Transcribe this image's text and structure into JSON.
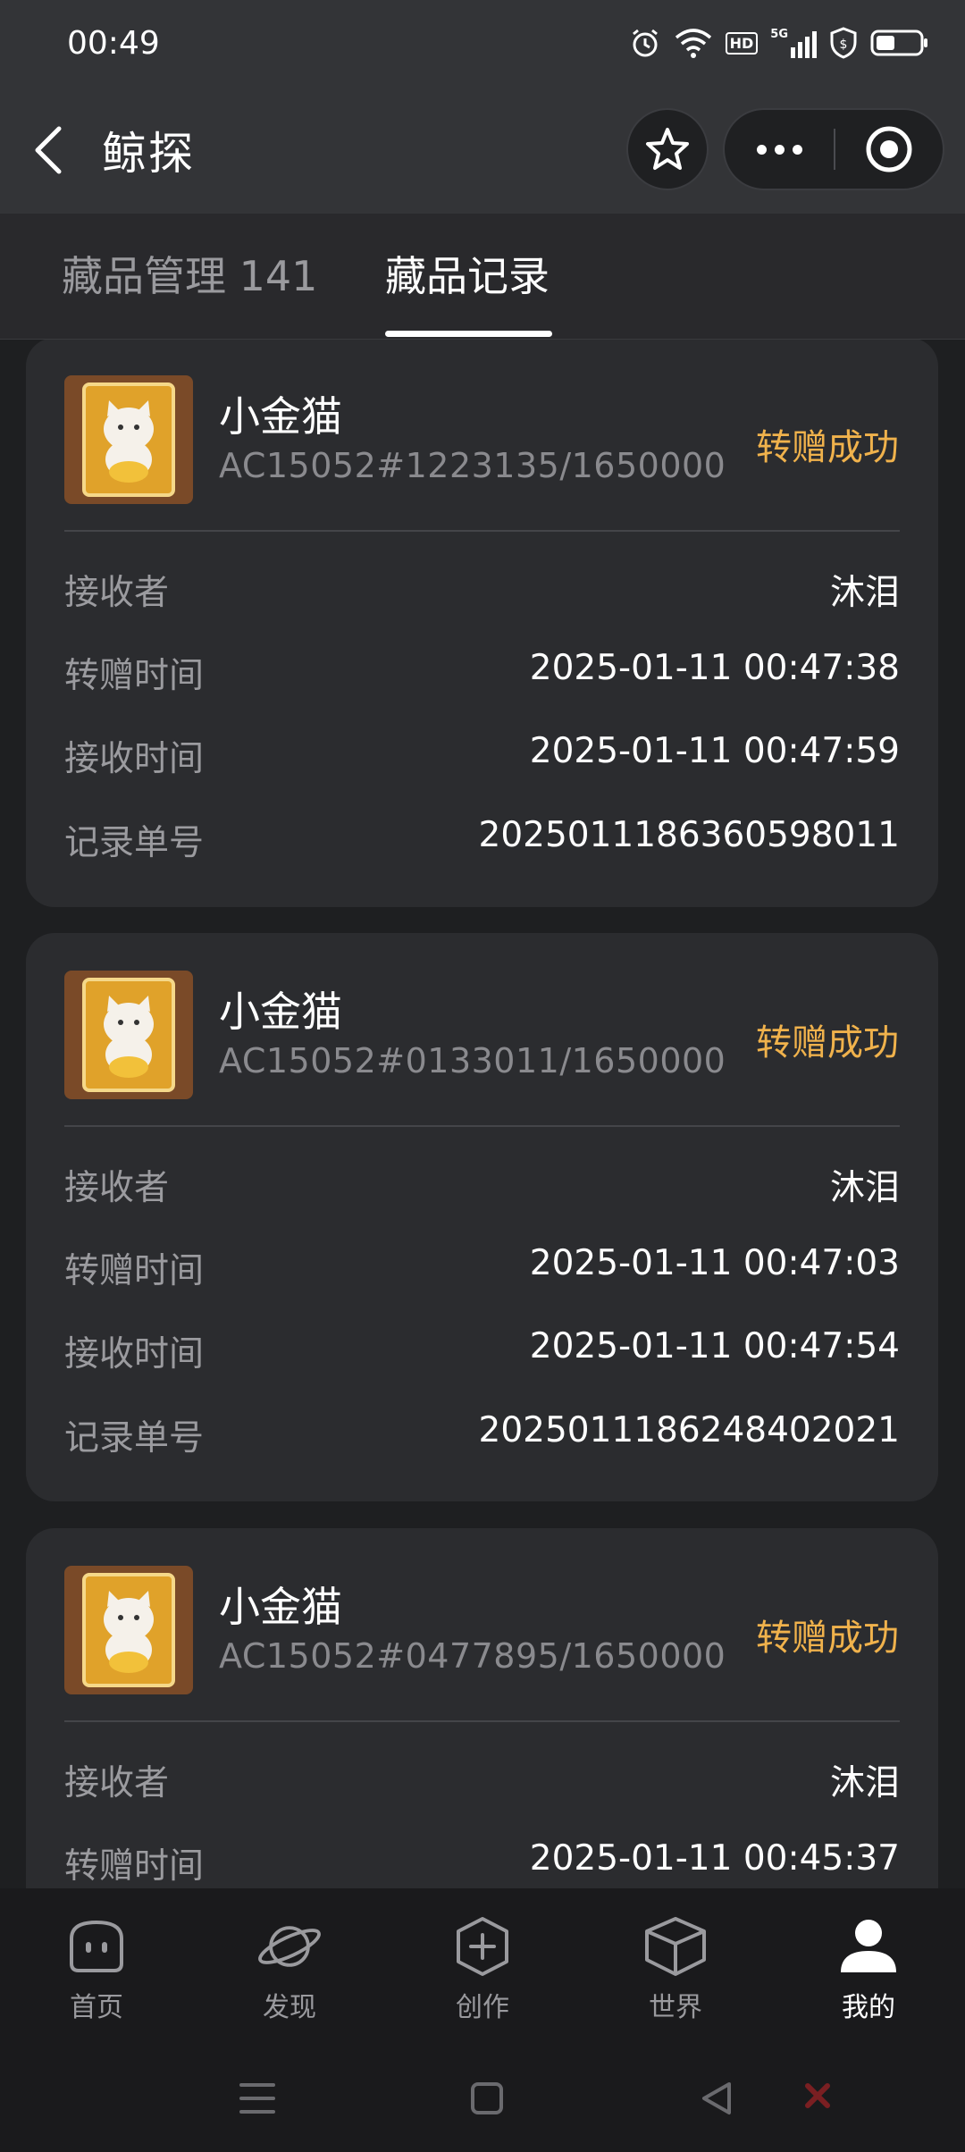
{
  "status_bar": {
    "time": "00:49",
    "icons": [
      "alarm-icon",
      "wifi-icon",
      "hd-icon",
      "5g-signal-icon",
      "shield-icon",
      "battery-icon"
    ],
    "hd_label": "HD",
    "net_label": "5G"
  },
  "navbar": {
    "title": "鲸探"
  },
  "tabs": [
    {
      "label": "藏品管理 141",
      "active": false
    },
    {
      "label": "藏品记录",
      "active": true
    }
  ],
  "records": [
    {
      "name": "小金猫",
      "serial": "AC15052#1223135/1650000",
      "status": "转赠成功",
      "fields": [
        {
          "label": "接收者",
          "value": "沐泪"
        },
        {
          "label": "转赠时间",
          "value": "2025-01-11 00:47:38"
        },
        {
          "label": "接收时间",
          "value": "2025-01-11 00:47:59"
        },
        {
          "label": "记录单号",
          "value": "2025011186360598011"
        }
      ]
    },
    {
      "name": "小金猫",
      "serial": "AC15052#0133011/1650000",
      "status": "转赠成功",
      "fields": [
        {
          "label": "接收者",
          "value": "沐泪"
        },
        {
          "label": "转赠时间",
          "value": "2025-01-11 00:47:03"
        },
        {
          "label": "接收时间",
          "value": "2025-01-11 00:47:54"
        },
        {
          "label": "记录单号",
          "value": "2025011186248402021"
        }
      ]
    },
    {
      "name": "小金猫",
      "serial": "AC15052#0477895/1650000",
      "status": "转赠成功",
      "fields": [
        {
          "label": "接收者",
          "value": "沐泪"
        },
        {
          "label": "转赠时间",
          "value": "2025-01-11 00:45:37"
        }
      ]
    }
  ],
  "bottom_nav": [
    {
      "label": "首页",
      "icon": "home-icon",
      "active": false
    },
    {
      "label": "发现",
      "icon": "planet-icon",
      "active": false
    },
    {
      "label": "创作",
      "icon": "plus-circle-icon",
      "active": false
    },
    {
      "label": "世界",
      "icon": "cube-icon",
      "active": false
    },
    {
      "label": "我的",
      "icon": "person-icon",
      "active": true
    }
  ],
  "colors": {
    "status_accent": "#f0b24c",
    "background": "#1e1f21",
    "card": "#2b2c2f"
  }
}
